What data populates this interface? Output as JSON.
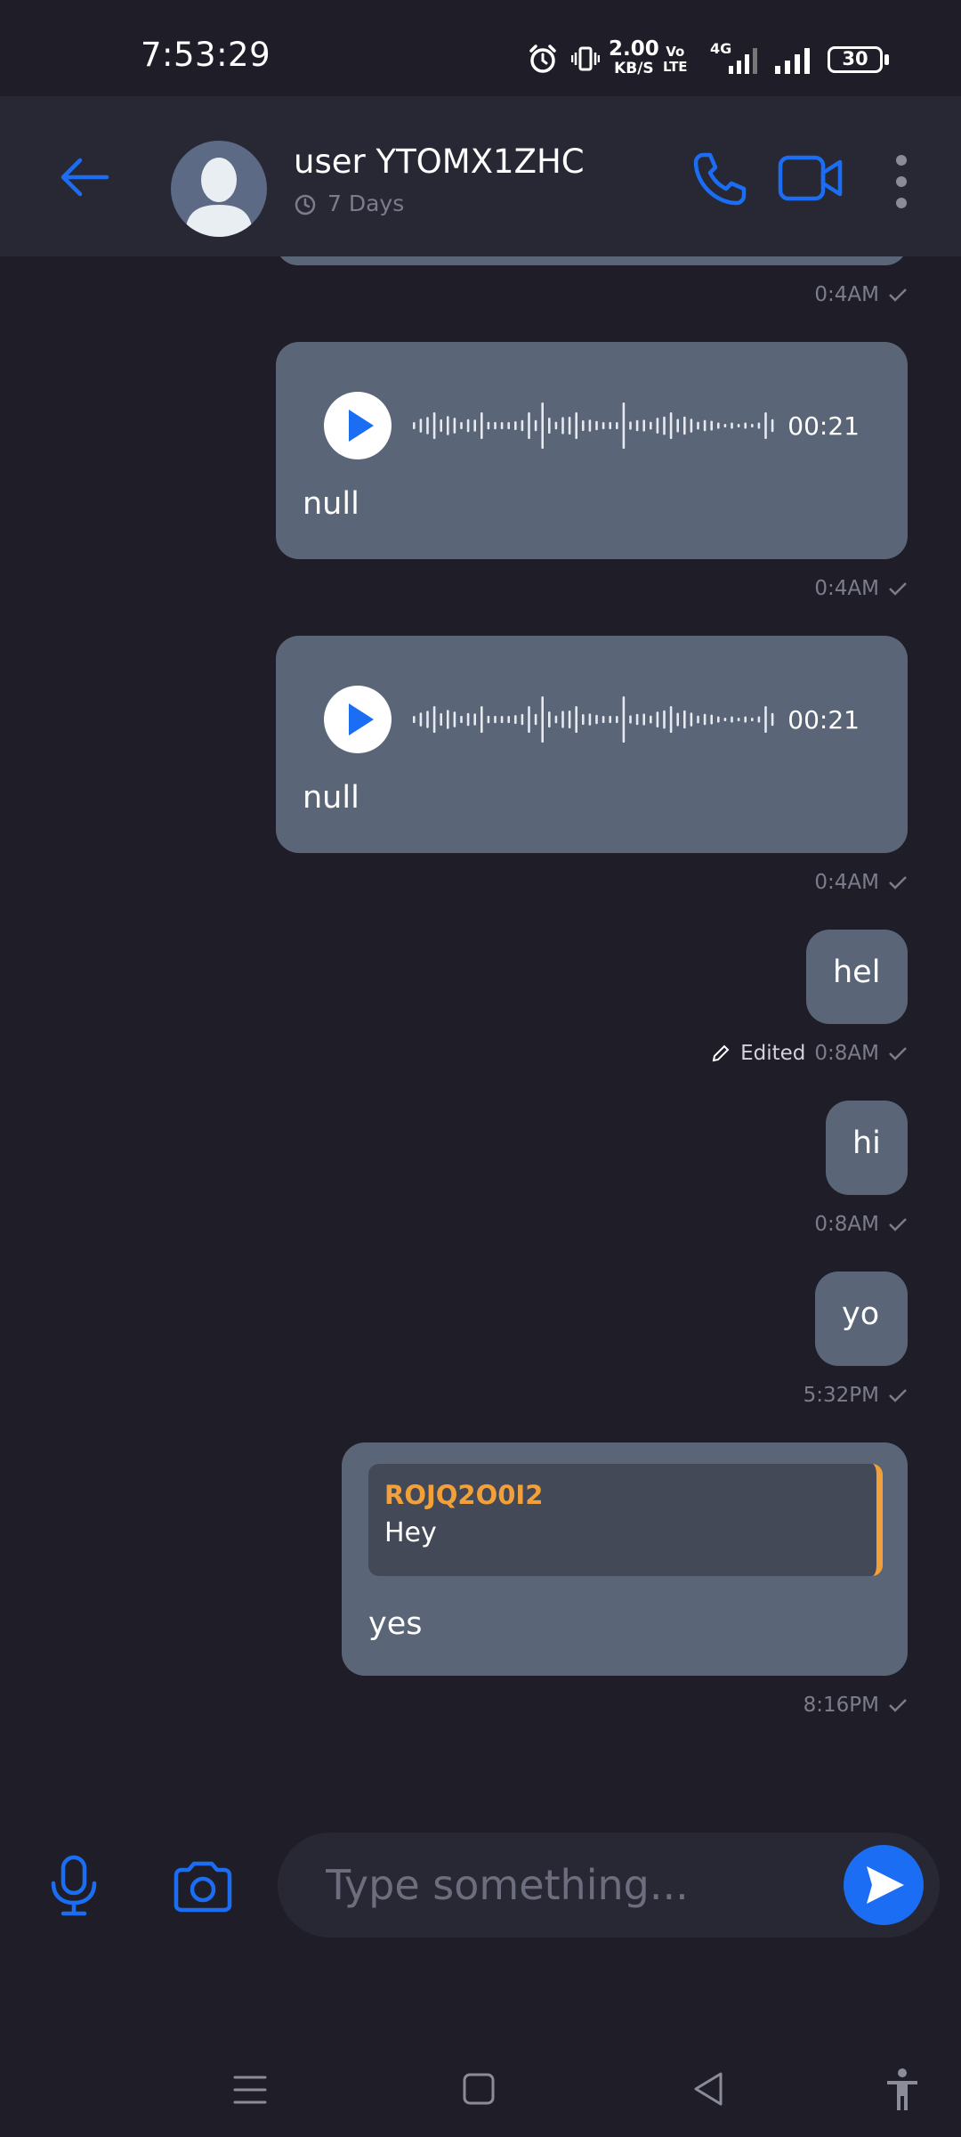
{
  "status_bar": {
    "time": "7:53:29",
    "speed_value": "2.00",
    "speed_unit": "KB/S",
    "volte_line1": "Vo",
    "volte_line2": "LTE",
    "network": "4G",
    "battery": "30"
  },
  "header": {
    "contact_name": "user YTOMX1ZHC",
    "last_seen": "7 Days",
    "icons": [
      "back-arrow-icon",
      "avatar",
      "clock-icon",
      "phone-icon",
      "video-camera-icon",
      "more-vert-icon"
    ]
  },
  "messages": {
    "top_time": "0:4AM",
    "voice1": {
      "duration": "00:21",
      "caption": "null",
      "time": "0:4AM"
    },
    "voice2": {
      "duration": "00:21",
      "caption": "null",
      "time": "0:4AM"
    },
    "msg_hel": {
      "text": "hel",
      "edited": "Edited",
      "time": "0:8AM"
    },
    "msg_hi": {
      "text": "hi",
      "time": "0:8AM"
    },
    "msg_yo": {
      "text": "yo",
      "time": "5:32PM"
    },
    "msg_yes": {
      "reply_author": "ROJQ2O0I2",
      "reply_text": "Hey",
      "text": "yes",
      "time": "8:16PM"
    }
  },
  "composer": {
    "placeholder": "Type something..."
  },
  "colors": {
    "background": "#1f1e28",
    "bar": "#282835",
    "bubble": "#5a6577",
    "accent": "#1b6ef3",
    "reply_accent": "#f2a13a",
    "muted": "#7b7d8c"
  }
}
